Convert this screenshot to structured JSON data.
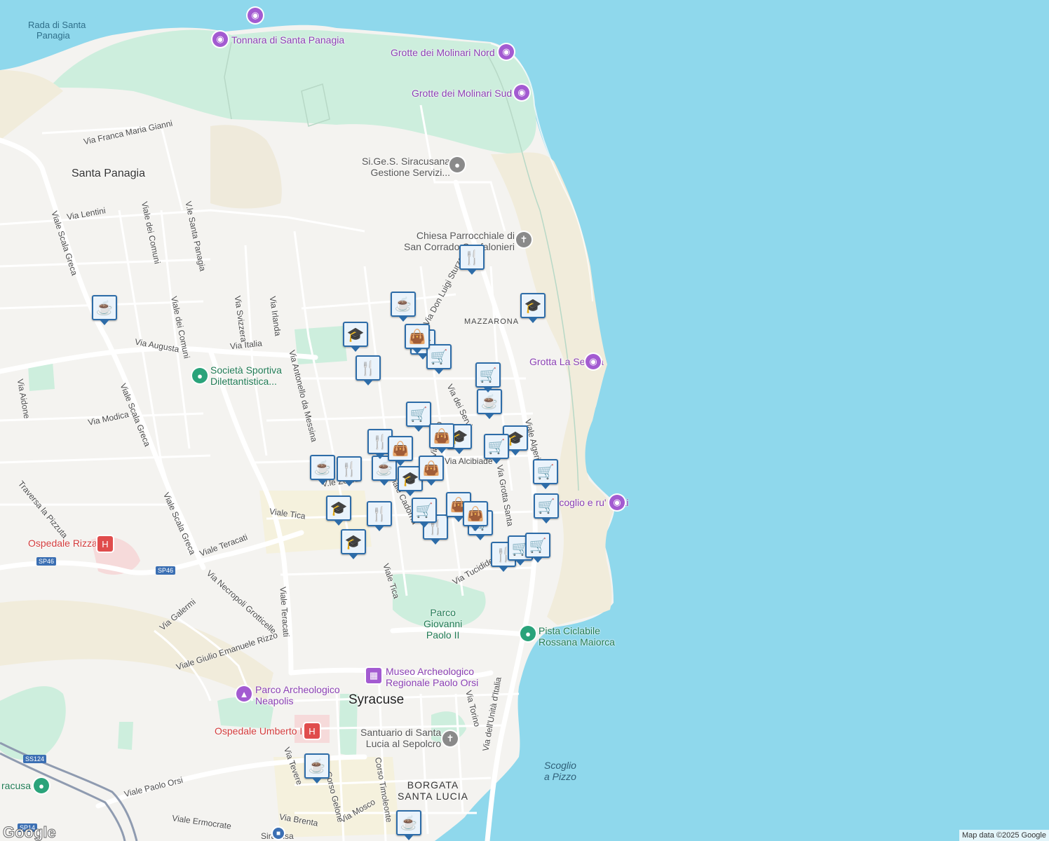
{
  "map": {
    "places": {
      "santa_panagia": "Santa Panagia",
      "syracuse": "Syracuse",
      "mazzarona": "MAZZARONA",
      "borgata": "BORGATA\nSANTA LUCIA",
      "borgata_l1": "BORGATA",
      "borgata_l2": "SANTA LUCIA",
      "rada_l1": "Rada di Santa",
      "rada_l2": "Panagia",
      "scoglio_l1": "Scoglio",
      "scoglio_l2": "a Pizzo",
      "siracusa": "Siracusa",
      "siracusa_station": "racusa"
    },
    "roads": {
      "franca_maria_gianni": "Via Franca Maria Gianni",
      "lentini": "Via Lentini",
      "viale_dei_comuni_1": "Viale dei Comuni",
      "viale_dei_comuni_2": "Viale dei Comuni",
      "santa_panagia": "V.le Santa Panagia",
      "scala_greca_1": "Viale Scala Greca",
      "scala_greca_2": "Viale Scala Greca",
      "scala_greca_3": "Viale Scala Greca",
      "svizzera": "Via Svizzera",
      "irlanda": "Via Irlanda",
      "italia": "Via Italia",
      "augusta": "Via Augusta",
      "antonello": "Via Antonello da Messina",
      "don_luigi_sturzo": "Via Don Luigi Sturzo",
      "aidone": "Via Aidone",
      "modica": "Via Modica",
      "pizzuta": "Traversa la Pizzuta",
      "teracati_1": "Viale Teracati",
      "teracati_2": "Viale Teracati",
      "tica_1": "Viale Tica",
      "tica_2": "Viale Tica",
      "necropoli": "Via Necropoli Grotticelle",
      "galermi": "Via Galermi",
      "rizzo": "Viale Giulio Emanuele Rizzo",
      "tucidide": "Via Tucidide",
      "grotta_santa": "Via Grotta Santa",
      "algeri": "Viale Algeri",
      "unita": "Via dell'Unità d'Italia",
      "torino": "Via Torino",
      "paolo_orsi": "Viale Paolo Orsi",
      "ermocrate": "Viale Ermocrate",
      "brenta": "Via Brenta",
      "mosco": "Via Mosco",
      "timoleonte": "Corso Timoleonte",
      "tevere": "Via Tevere",
      "gelone": "Corso Gelone",
      "alcibiade": "Via Alcibiade",
      "dei_servi": "Via dei Servi",
      "filisto": "Via Filisto",
      "zeuxi": "V.le Zeuxi",
      "cadorna": "Viale Cadorna"
    },
    "pois": {
      "tonnara": "Tonnara di Santa Panagia",
      "molinari_nord": "Grotte dei Molinari Nord",
      "molinari_sud": "Grotte dei Molinari Sud",
      "sigess_l1": "Si.Ge.S. Siracusana",
      "sigess_l2": "Gestione Servizi...",
      "chiesa_l1": "Chiesa Parrocchiale di",
      "chiesa_l2": "San Corrado Confalonieri",
      "grotta_seggia": "Grotta La Seggia",
      "scoglio_frati": "Scoglio e ru' Frati",
      "societa_l1": "Società Sportiva",
      "societa_l2": "Dilettantistica...",
      "ospedale_rizza": "Ospedale Rizza",
      "parco_gp_l1": "Parco",
      "parco_gp_l2": "Giovanni",
      "parco_gp_l3": "Paolo II",
      "pista_l1": "Pista Ciclabile",
      "pista_l2": "Rossana Maiorca",
      "museo_l1": "Museo Archeologico",
      "museo_l2": "Regionale Paolo Orsi",
      "neapolis_l1": "Parco Archeologico",
      "neapolis_l2": "Neapolis",
      "umberto": "Ospedale Umberto I",
      "santuario_l1": "Santuario di Santa",
      "santuario_l2": "Lucia al Sepolcro"
    },
    "route_shields": {
      "sp46_a": "SP46",
      "sp46_b": "SP46",
      "ss124": "SS124",
      "sp14": "SP14"
    },
    "attribution": "Map data ©2025 Google",
    "logo": "Google",
    "colors": {
      "sea": "#8fd8ec",
      "land": "#f4f3f0",
      "park": "#cdeedd",
      "beach": "#f1ecdb",
      "marker_border": "#2d6ca8",
      "marker_bg": "#eaf3fb"
    },
    "markers": [
      {
        "type": "cafe-icon",
        "glyph": "☕"
      },
      {
        "type": "restaurant-icon",
        "glyph": "🍴"
      },
      {
        "type": "school-icon",
        "glyph": "🎓"
      },
      {
        "type": "shopping-cart-icon",
        "glyph": "🛒"
      },
      {
        "type": "shopping-bag-icon",
        "glyph": "👜"
      }
    ]
  }
}
